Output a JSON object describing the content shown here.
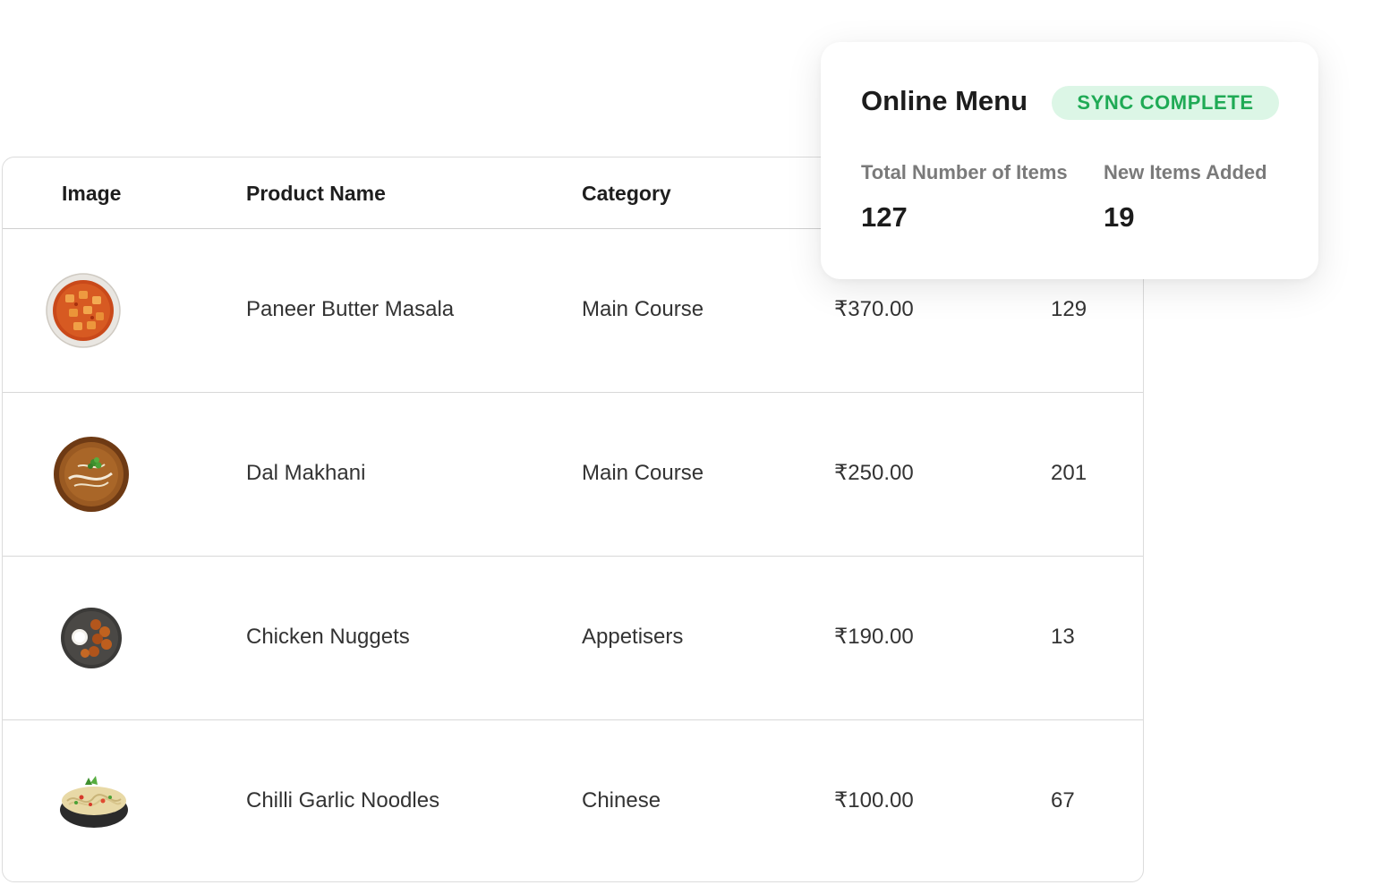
{
  "table": {
    "headers": {
      "image": "Image",
      "product_name": "Product Name",
      "category": "Category"
    },
    "rows": [
      {
        "image_icon": "paneer-butter-masala-dish",
        "name": "Paneer Butter Masala",
        "category": "Main Course",
        "price": "₹370.00",
        "quantity": "129"
      },
      {
        "image_icon": "dal-makhani-dish",
        "name": "Dal Makhani",
        "category": "Main Course",
        "price": "₹250.00",
        "quantity": "201"
      },
      {
        "image_icon": "chicken-nuggets-dish",
        "name": "Chicken Nuggets",
        "category": "Appetisers",
        "price": "₹190.00",
        "quantity": "13"
      },
      {
        "image_icon": "chilli-garlic-noodles-dish",
        "name": "Chilli Garlic Noodles",
        "category": "Chinese",
        "price": "₹100.00",
        "quantity": "67"
      }
    ]
  },
  "summary": {
    "title": "Online Menu",
    "badge": "SYNC COMPLETE",
    "stats": [
      {
        "label": "Total Number of Items",
        "value": "127"
      },
      {
        "label": "New Items Added",
        "value": "19"
      }
    ]
  },
  "colors": {
    "badge_bg": "#dcf6e6",
    "badge_text": "#1faa55",
    "border": "#dcdcdc"
  }
}
